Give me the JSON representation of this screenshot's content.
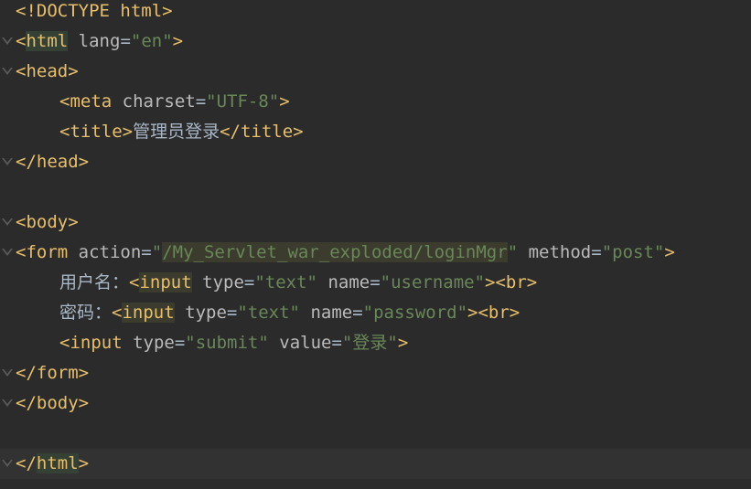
{
  "lines": [
    {
      "parts": [
        {
          "t": "tag",
          "v": "<!DOCTYPE html>"
        }
      ]
    },
    {
      "parts": [
        {
          "t": "tag",
          "v": "<"
        },
        {
          "t": "tag-hl",
          "v": "html"
        },
        {
          "t": "plain",
          "v": " "
        },
        {
          "t": "attr",
          "v": "lang"
        },
        {
          "t": "plain",
          "v": "="
        },
        {
          "t": "str",
          "v": "\"en\""
        },
        {
          "t": "tag",
          "v": ">"
        }
      ]
    },
    {
      "parts": [
        {
          "t": "tag",
          "v": "<head>"
        }
      ]
    },
    {
      "parts": [
        {
          "t": "tag",
          "v": "<meta "
        },
        {
          "t": "attr",
          "v": "charset"
        },
        {
          "t": "plain",
          "v": "="
        },
        {
          "t": "str",
          "v": "\"UTF-8\""
        },
        {
          "t": "tag",
          "v": ">"
        }
      ]
    },
    {
      "parts": [
        {
          "t": "tag",
          "v": "<title>"
        },
        {
          "t": "text",
          "v": "管理员登录"
        },
        {
          "t": "tag",
          "v": "</title>"
        }
      ]
    },
    {
      "parts": [
        {
          "t": "tag",
          "v": "</head>"
        }
      ]
    },
    {
      "parts": []
    },
    {
      "parts": [
        {
          "t": "tag",
          "v": "<body>"
        }
      ]
    },
    {
      "parts": [
        {
          "t": "tag",
          "v": "<form "
        },
        {
          "t": "attr",
          "v": "action"
        },
        {
          "t": "plain",
          "v": "="
        },
        {
          "t": "str",
          "v": "\""
        },
        {
          "t": "str-hl",
          "v": "/My_Servlet_war_exploded/loginMgr"
        },
        {
          "t": "str",
          "v": "\""
        },
        {
          "t": "plain",
          "v": " "
        },
        {
          "t": "attr",
          "v": "method"
        },
        {
          "t": "plain",
          "v": "="
        },
        {
          "t": "str",
          "v": "\"post\""
        },
        {
          "t": "tag",
          "v": ">"
        }
      ]
    },
    {
      "parts": [
        {
          "t": "text",
          "v": "用户名："
        },
        {
          "t": "tag",
          "v": "<"
        },
        {
          "t": "tag-hl2",
          "v": "input"
        },
        {
          "t": "plain",
          "v": " "
        },
        {
          "t": "attr",
          "v": "type"
        },
        {
          "t": "plain",
          "v": "="
        },
        {
          "t": "str",
          "v": "\"text\""
        },
        {
          "t": "plain",
          "v": " "
        },
        {
          "t": "attr",
          "v": "name"
        },
        {
          "t": "plain",
          "v": "="
        },
        {
          "t": "str",
          "v": "\"username\""
        },
        {
          "t": "tag",
          "v": "><br>"
        }
      ]
    },
    {
      "parts": [
        {
          "t": "text",
          "v": "密码："
        },
        {
          "t": "tag",
          "v": "<"
        },
        {
          "t": "tag-hl2",
          "v": "input"
        },
        {
          "t": "plain",
          "v": " "
        },
        {
          "t": "attr",
          "v": "type"
        },
        {
          "t": "plain",
          "v": "="
        },
        {
          "t": "str",
          "v": "\"text\""
        },
        {
          "t": "plain",
          "v": " "
        },
        {
          "t": "attr",
          "v": "name"
        },
        {
          "t": "plain",
          "v": "="
        },
        {
          "t": "str",
          "v": "\"password\""
        },
        {
          "t": "tag",
          "v": "><br>"
        }
      ]
    },
    {
      "parts": [
        {
          "t": "tag",
          "v": "<input "
        },
        {
          "t": "attr",
          "v": "type"
        },
        {
          "t": "plain",
          "v": "="
        },
        {
          "t": "str",
          "v": "\"submit\""
        },
        {
          "t": "plain",
          "v": " "
        },
        {
          "t": "attr",
          "v": "value"
        },
        {
          "t": "plain",
          "v": "="
        },
        {
          "t": "str",
          "v": "\"登录\""
        },
        {
          "t": "tag",
          "v": ">"
        }
      ]
    },
    {
      "parts": [
        {
          "t": "tag",
          "v": "</form>"
        }
      ]
    },
    {
      "parts": [
        {
          "t": "tag",
          "v": "</body>"
        }
      ]
    },
    {
      "parts": []
    },
    {
      "parts": [
        {
          "t": "tag",
          "v": "</"
        },
        {
          "t": "tag-hl",
          "v": "html"
        },
        {
          "t": "tag",
          "v": ">"
        }
      ]
    }
  ],
  "colors": {
    "background": "#2b2b2b",
    "current_line": "#323232",
    "tag": "#e8bf6a",
    "attribute": "#bababa",
    "string": "#6a8759",
    "plain": "#a9b7c6"
  }
}
